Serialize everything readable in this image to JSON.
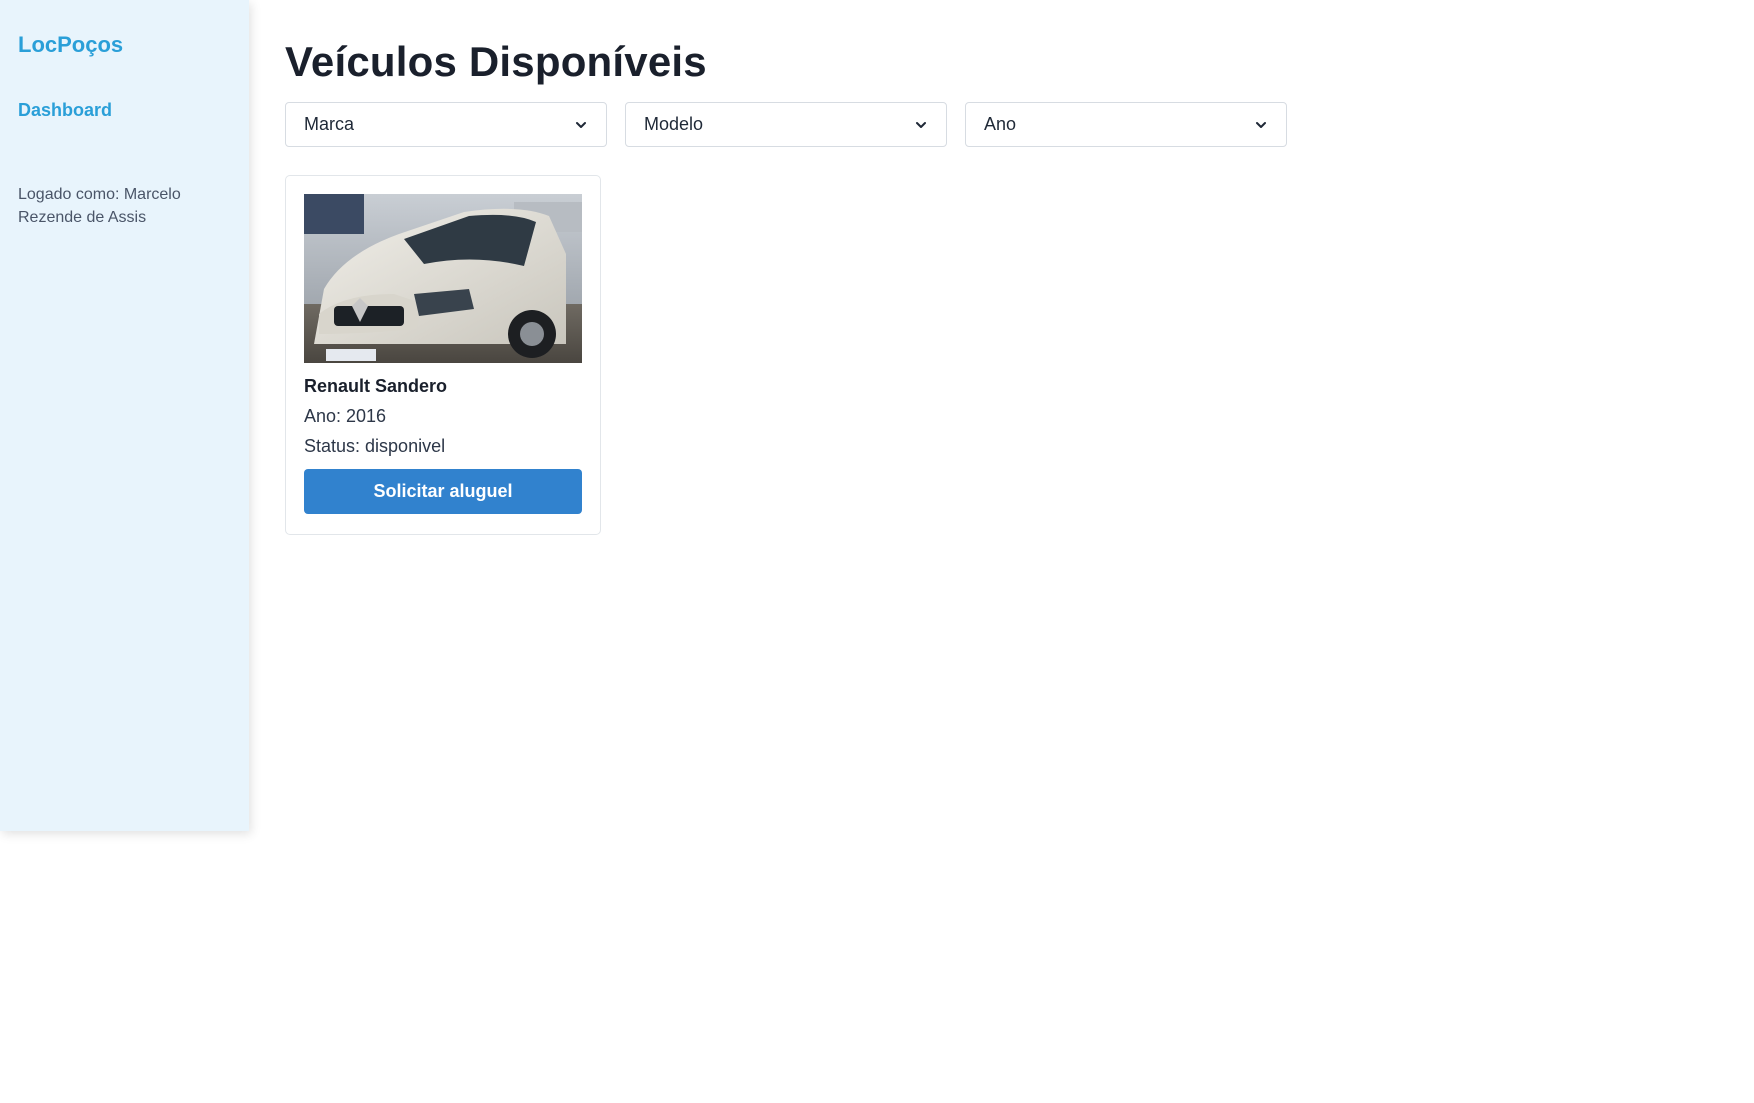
{
  "sidebar": {
    "brand": "LocPoços",
    "nav": [
      {
        "label": "Dashboard"
      }
    ],
    "user_info": "Logado como: Marcelo Rezende de Assis"
  },
  "main": {
    "title": "Veículos Disponíveis",
    "filters": [
      {
        "value": "Marca",
        "icon": "chevron-down-icon"
      },
      {
        "value": "Modelo",
        "icon": "chevron-down-icon"
      },
      {
        "value": "Ano",
        "icon": "chevron-down-icon"
      }
    ],
    "vehicles": [
      {
        "name": "Renault Sandero",
        "year_line": "Ano: 2016",
        "status_line": "Status: disponivel",
        "button_label": "Solicitar aluguel"
      }
    ]
  },
  "colors": {
    "accent": "#2a9fd8",
    "button": "#3182ce",
    "sidebar_bg": "#e8f4fc"
  }
}
